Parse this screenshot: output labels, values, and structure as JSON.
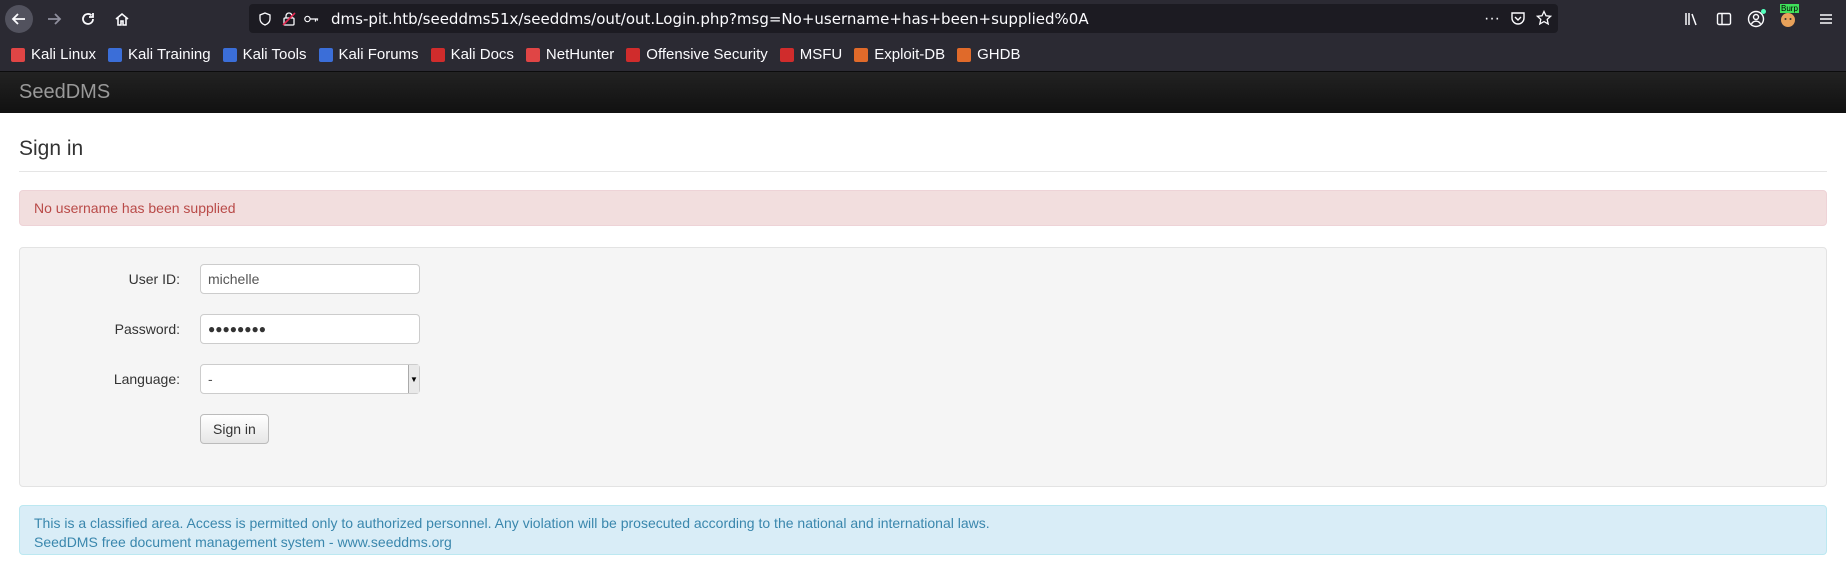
{
  "browser": {
    "url": "dms-pit.htb/seeddms51x/seeddms/out/out.Login.php?msg=No+username+has+been+supplied%0A",
    "burp_badge": "Burp",
    "bookmarks": [
      {
        "label": "Kali Linux",
        "icon": "kali-icon",
        "color": "#e04545"
      },
      {
        "label": "Kali Training",
        "icon": "kali-training-icon",
        "color": "#3b6ed8"
      },
      {
        "label": "Kali Tools",
        "icon": "kali-tools-icon",
        "color": "#3b6ed8"
      },
      {
        "label": "Kali Forums",
        "icon": "kali-forums-icon",
        "color": "#3b6ed8"
      },
      {
        "label": "Kali Docs",
        "icon": "kali-docs-icon",
        "color": "#d02c2c"
      },
      {
        "label": "NetHunter",
        "icon": "nethunter-icon",
        "color": "#e04545"
      },
      {
        "label": "Offensive Security",
        "icon": "offsec-icon",
        "color": "#d02c2c"
      },
      {
        "label": "MSFU",
        "icon": "msfu-icon",
        "color": "#d02c2c"
      },
      {
        "label": "Exploit-DB",
        "icon": "exploitdb-icon",
        "color": "#e06a2a"
      },
      {
        "label": "GHDB",
        "icon": "ghdb-icon",
        "color": "#e06a2a"
      }
    ]
  },
  "app": {
    "brand": "SeedDMS",
    "title": "Sign in",
    "error_message": "No username has been supplied",
    "form": {
      "userid_label": "User ID:",
      "userid_value": "michelle",
      "password_label": "Password:",
      "password_mask": "●●●●●●●●",
      "language_label": "Language:",
      "language_value": "-",
      "submit_label": "Sign in"
    },
    "footer": {
      "line1": "This is a classified area. Access is permitted only to authorized personnel. Any violation will be prosecuted according to the national and international laws.",
      "line2": "SeedDMS free document management system - www.seeddms.org"
    }
  }
}
